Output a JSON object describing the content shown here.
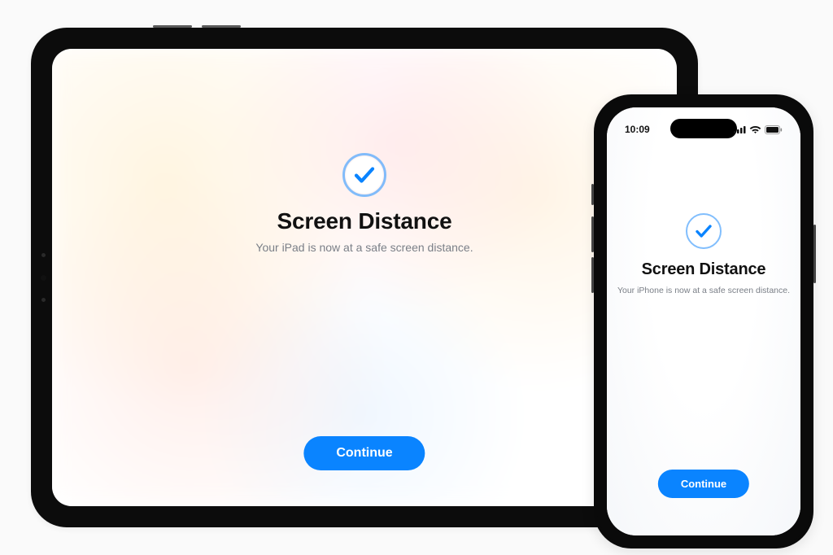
{
  "accent_color": "#0a84ff",
  "ipad": {
    "title": "Screen Distance",
    "subtitle": "Your iPad is now at a safe screen distance.",
    "continue_label": "Continue",
    "icon": "checkmark-circle"
  },
  "iphone": {
    "status_time": "10:09",
    "title": "Screen Distance",
    "subtitle": "Your iPhone is now at a safe screen distance.",
    "continue_label": "Continue",
    "icon": "checkmark-circle"
  }
}
